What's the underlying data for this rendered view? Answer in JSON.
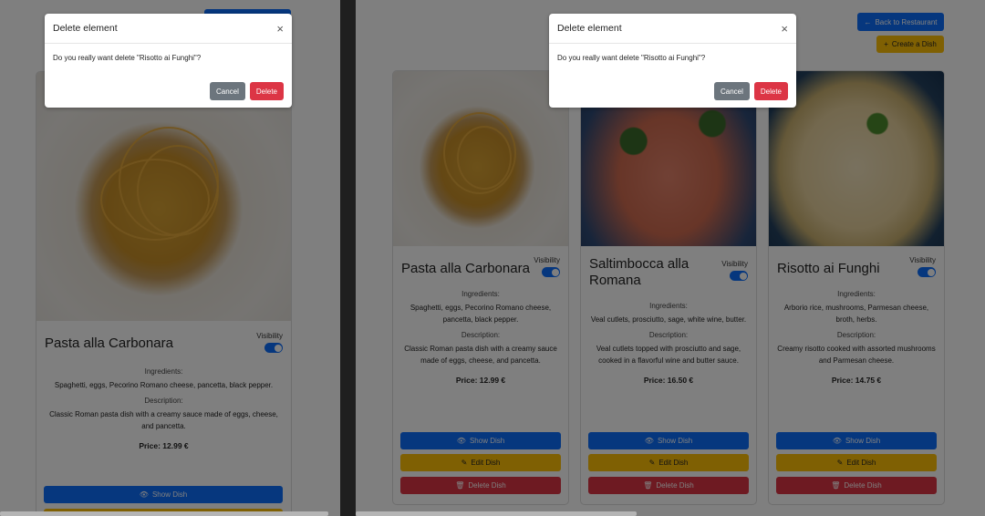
{
  "modal": {
    "title": "Delete element",
    "body": "Do you really want delete \"Risotto ai Funghi\"?",
    "cancel": "Cancel",
    "delete": "Delete",
    "close_glyph": "×"
  },
  "header": {
    "back_label": "Back to Restaurant",
    "create_label": "Create a Dish"
  },
  "labels": {
    "visibility": "Visibility",
    "ingredients": "Ingredients:",
    "description": "Description:",
    "show": "Show Dish",
    "edit": "Edit Dish",
    "delete": "Delete Dish"
  },
  "dishes": [
    {
      "name": "Pasta alla Carbonara",
      "ingredients": "Spaghetti, eggs, Pecorino Romano cheese, pancetta, black pepper.",
      "description": "Classic Roman pasta dish with a creamy sauce made of eggs, cheese, and pancetta.",
      "price": "Price: 12.99 €",
      "visible": true
    },
    {
      "name": "Saltimbocca alla Romana",
      "ingredients": "Veal cutlets, prosciutto, sage, white wine, butter.",
      "description": "Veal cutlets topped with prosciutto and sage, cooked in a flavorful wine and butter sauce.",
      "price": "Price: 16.50 €",
      "visible": true
    },
    {
      "name": "Risotto ai Funghi",
      "ingredients": "Arborio rice, mushrooms, Parmesan cheese, broth, herbs.",
      "description": "Creamy risotto cooked with assorted mushrooms and Parmesan cheese.",
      "price": "Price: 14.75 €",
      "visible": true
    }
  ],
  "colors": {
    "primary": "#0d6efd",
    "warning": "#ffc107",
    "danger": "#dc3545",
    "secondary": "#6c757d"
  }
}
